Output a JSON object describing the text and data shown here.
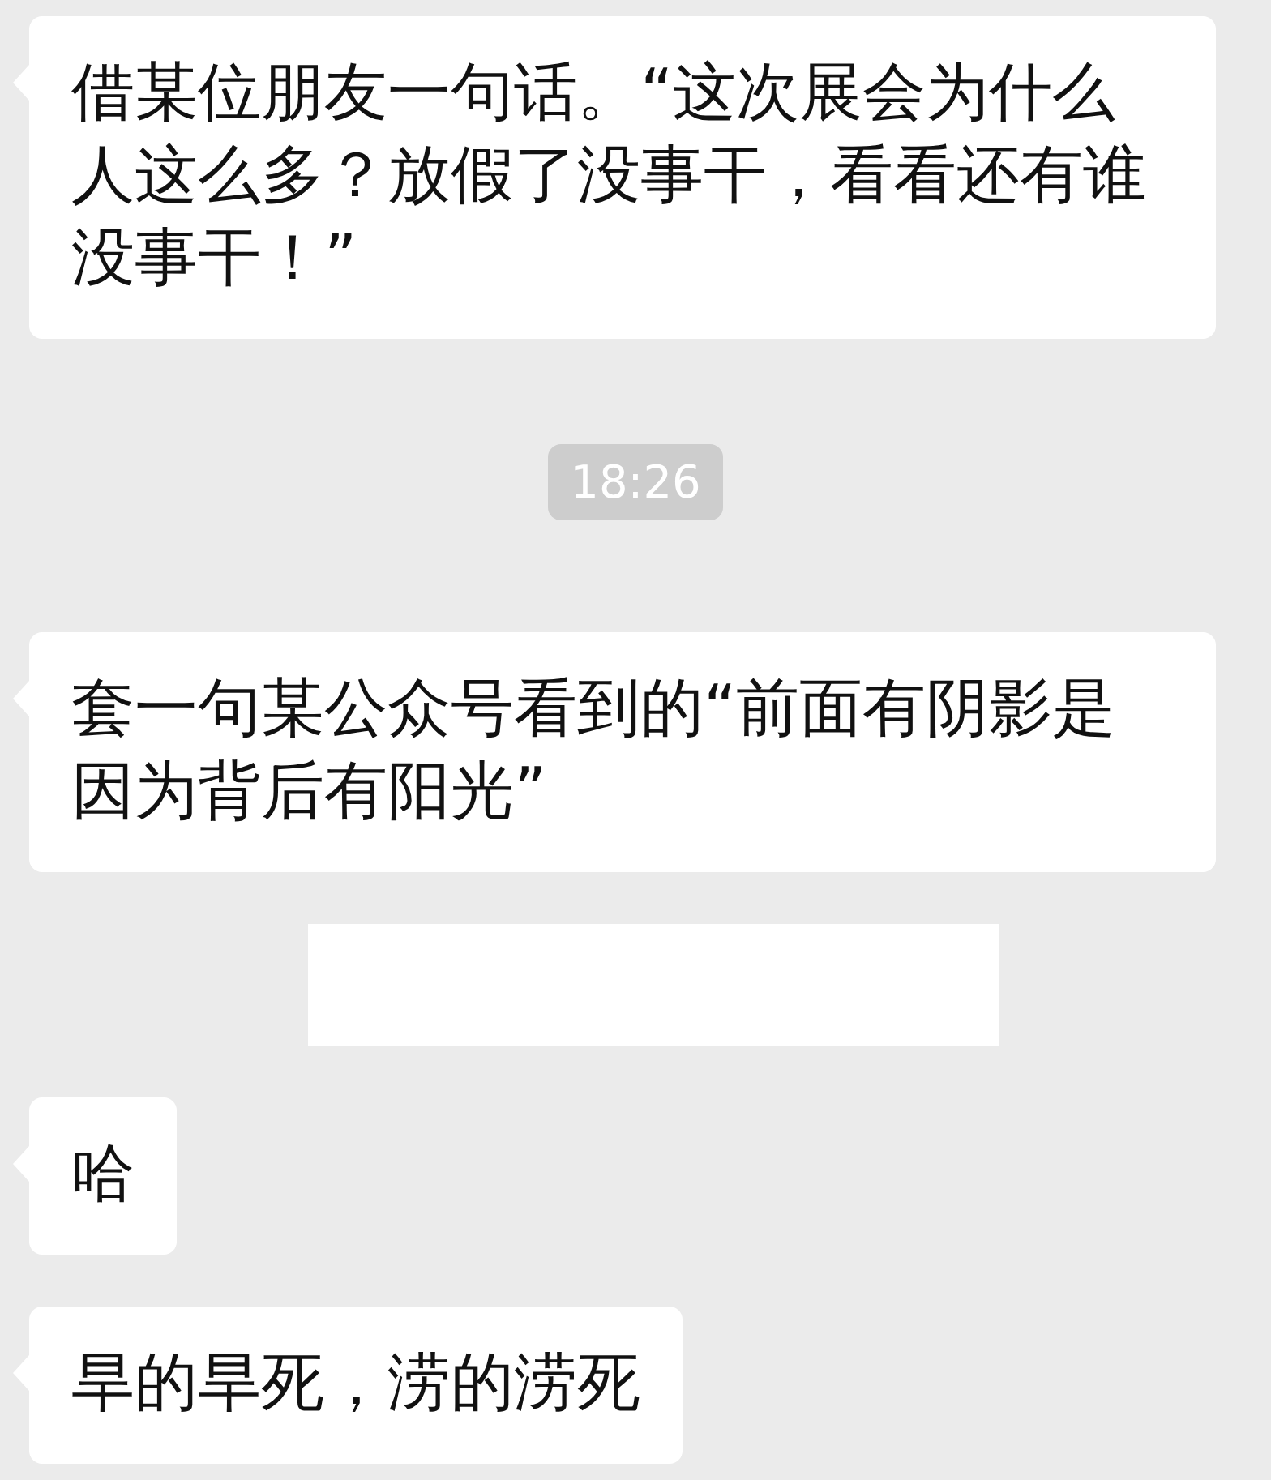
{
  "messages": [
    {
      "kind": "text",
      "text": "借某位朋友一句话。“这次展会为什么人这么多？放假了没事干，看看还有谁没事干！”"
    },
    {
      "kind": "time",
      "text": "18:26"
    },
    {
      "kind": "text",
      "text": "套一句某公众号看到的“前面有阴影是因为背后有阳光”"
    },
    {
      "kind": "redacted"
    },
    {
      "kind": "text",
      "text": "哈"
    },
    {
      "kind": "text",
      "text": "旱的旱死，涝的涝死"
    }
  ]
}
